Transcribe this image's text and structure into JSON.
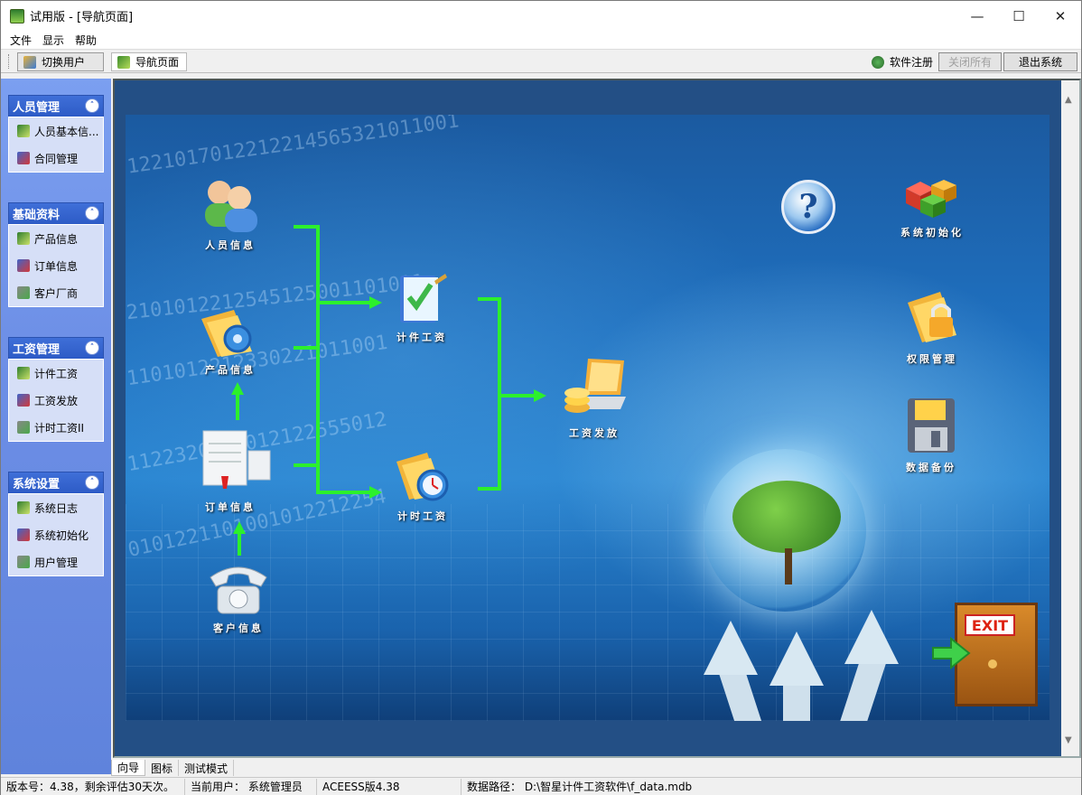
{
  "window": {
    "title": "试用版 - [导航页面]"
  },
  "menu": [
    "文件",
    "显示",
    "帮助"
  ],
  "toolbar": {
    "switch_user": "切换用户",
    "nav_tab": "导航页面",
    "register": "软件注册",
    "close_all": "关闭所有",
    "exit_system": "退出系统"
  },
  "sidebar": {
    "groups": [
      {
        "title": "人员管理",
        "items": [
          "人员基本信...",
          "合同管理"
        ]
      },
      {
        "title": "基础资料",
        "items": [
          "产品信息",
          "订单信息",
          "客户厂商"
        ]
      },
      {
        "title": "工资管理",
        "items": [
          "计件工资",
          "工资发放",
          "计时工资II"
        ]
      },
      {
        "title": "系统设置",
        "items": [
          "系统日志",
          "系统初始化",
          "用户管理"
        ]
      }
    ]
  },
  "flow": {
    "personnel": "人员信息",
    "product": "产品信息",
    "order": "订单信息",
    "customer": "客户信息",
    "piece_wage": "计件工资",
    "time_wage": "计时工资",
    "wage_pay": "工资发放",
    "sys_init": "系统初始化",
    "permission": "权限管理",
    "backup": "数据备份",
    "exit_label": "EXIT"
  },
  "bottom_tabs": [
    "向导",
    "图标",
    "测试模式"
  ],
  "status": {
    "version": "版本号：4.38，剩余评估30天次。",
    "user": "当前用户：  系统管理员",
    "db": "ACEESS版4.38",
    "path": "数据路径：  D:\\智星计件工资软件\\f_data.mdb"
  },
  "colors": {
    "flow_line": "#2cf02c",
    "sidebar_header": "#2d5bc6",
    "sidebar_body": "#d6dff7"
  }
}
